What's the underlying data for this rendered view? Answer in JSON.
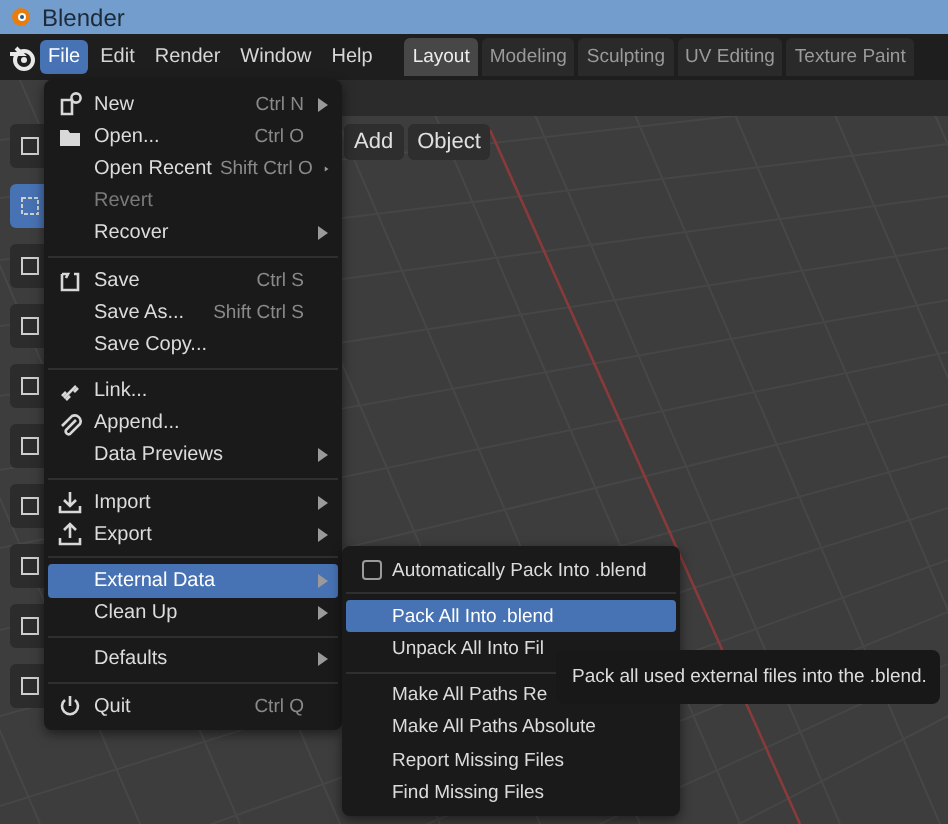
{
  "window": {
    "title": "Blender"
  },
  "menubar": [
    {
      "label": "File",
      "selected": true
    },
    {
      "label": "Edit",
      "selected": false
    },
    {
      "label": "Render",
      "selected": false
    },
    {
      "label": "Window",
      "selected": false
    },
    {
      "label": "Help",
      "selected": false
    }
  ],
  "workspace_tabs": [
    {
      "label": "Layout",
      "selected": true
    },
    {
      "label": "Modeling",
      "selected": false
    },
    {
      "label": "Sculpting",
      "selected": false
    },
    {
      "label": "UV Editing",
      "selected": false
    },
    {
      "label": "Texture Paint",
      "selected": false
    }
  ],
  "toolbar": [
    {
      "selected": false
    },
    {
      "selected": true
    },
    {
      "selected": false
    },
    {
      "selected": false
    },
    {
      "selected": false
    },
    {
      "selected": false
    },
    {
      "selected": false
    },
    {
      "selected": false
    },
    {
      "selected": false
    },
    {
      "selected": false
    }
  ],
  "header_buttons": [
    "Add",
    "Object"
  ],
  "file_menu": {
    "items": [
      {
        "kind": "item",
        "label": "New",
        "shortcut": "Ctrl N",
        "submenu": true,
        "disabled": false,
        "selected": false
      },
      {
        "kind": "item",
        "label": "Open...",
        "shortcut": "Ctrl O",
        "submenu": false,
        "disabled": false,
        "selected": false
      },
      {
        "kind": "item",
        "label": "Open Recent",
        "shortcut": "Shift Ctrl O",
        "submenu": true,
        "disabled": false,
        "selected": false
      },
      {
        "kind": "item",
        "label": "Revert",
        "submenu": false,
        "disabled": true,
        "selected": false
      },
      {
        "kind": "item",
        "label": "Recover",
        "submenu": true,
        "disabled": false,
        "selected": false
      },
      {
        "kind": "separator"
      },
      {
        "kind": "item",
        "label": "Save",
        "shortcut": "Ctrl S",
        "submenu": false,
        "disabled": false,
        "selected": false
      },
      {
        "kind": "item",
        "label": "Save As...",
        "shortcut": "Shift Ctrl S",
        "submenu": false,
        "disabled": false,
        "selected": false
      },
      {
        "kind": "item",
        "label": "Save Copy...",
        "submenu": false,
        "disabled": false,
        "selected": false
      },
      {
        "kind": "separator"
      },
      {
        "kind": "item",
        "label": "Link...",
        "submenu": false,
        "disabled": false,
        "selected": false
      },
      {
        "kind": "item",
        "label": "Append...",
        "submenu": false,
        "disabled": false,
        "selected": false
      },
      {
        "kind": "item",
        "label": "Data Previews",
        "submenu": true,
        "disabled": false,
        "selected": false
      },
      {
        "kind": "separator"
      },
      {
        "kind": "item",
        "label": "Import",
        "submenu": true,
        "disabled": false,
        "selected": false
      },
      {
        "kind": "item",
        "label": "Export",
        "submenu": true,
        "disabled": false,
        "selected": false
      },
      {
        "kind": "separator"
      },
      {
        "kind": "item",
        "label": "External Data",
        "submenu": true,
        "disabled": false,
        "selected": true
      },
      {
        "kind": "item",
        "label": "Clean Up",
        "submenu": true,
        "disabled": false,
        "selected": false
      },
      {
        "kind": "separator"
      },
      {
        "kind": "item",
        "label": "Defaults",
        "submenu": true,
        "disabled": false,
        "selected": false
      },
      {
        "kind": "separator"
      },
      {
        "kind": "item",
        "label": "Quit",
        "shortcut": "Ctrl Q",
        "submenu": false,
        "disabled": false,
        "selected": false
      }
    ]
  },
  "external_data_menu": {
    "items": [
      {
        "kind": "checkbox",
        "label": "Automatically Pack Into .blend",
        "checked": false,
        "selected": false
      },
      {
        "kind": "separator"
      },
      {
        "kind": "item",
        "label": "Pack All Into .blend",
        "selected": true
      },
      {
        "kind": "item",
        "label": "Unpack All Into Fil",
        "selected": false
      },
      {
        "kind": "separator"
      },
      {
        "kind": "item",
        "label": "Make All Paths Re",
        "selected": false
      },
      {
        "kind": "item",
        "label": "Make All Paths Absolute",
        "selected": false
      },
      {
        "kind": "item",
        "label": "Report Missing Files",
        "selected": false
      },
      {
        "kind": "item",
        "label": "Find Missing Files",
        "selected": false
      }
    ]
  },
  "tooltip": "Pack all used external files into the .blend."
}
